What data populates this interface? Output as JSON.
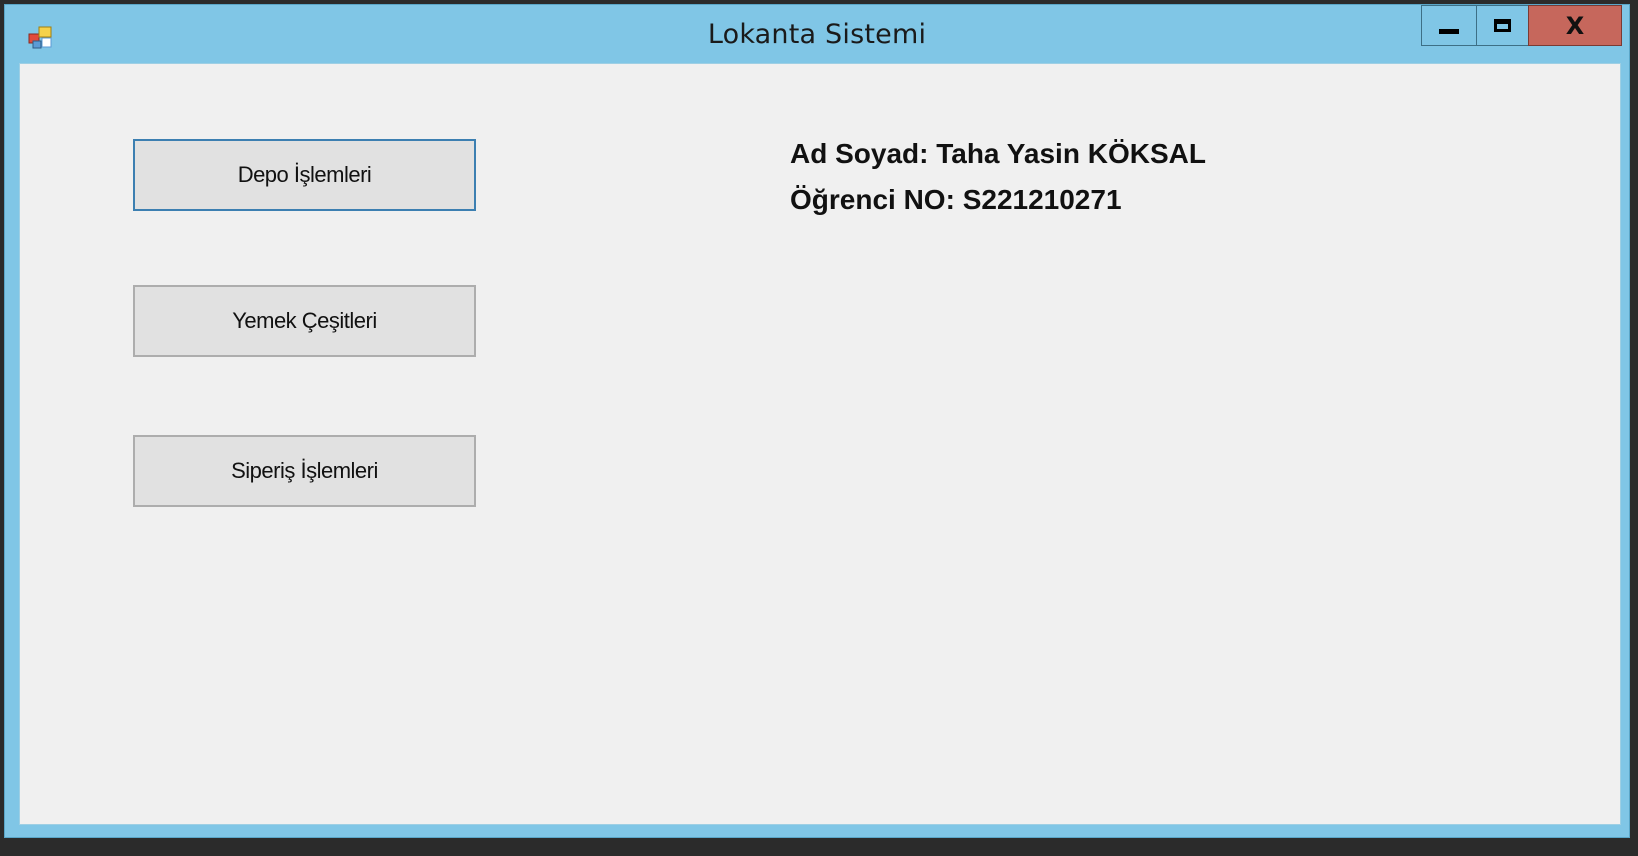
{
  "window": {
    "title": "Lokanta Sistemi",
    "icon": "app-window-icon",
    "controls": {
      "minimize_icon": "minimize-icon",
      "maximize_icon": "maximize-icon",
      "close_label": "X"
    }
  },
  "buttons": {
    "depo": "Depo İşlemleri",
    "yemek": "Yemek Çeşitleri",
    "siparis": "Siperiş İşlemleri"
  },
  "info": {
    "name_line": "Ad Soyad: Taha Yasin KÖKSAL",
    "student_no_line": "Öğrenci NO: S221210271"
  },
  "colors": {
    "titlebar": "#80c6e6",
    "close_button": "#c6675c",
    "client_background": "#f0f0f0",
    "button_face": "#e1e1e1",
    "focus_border": "#3c7fb1"
  }
}
